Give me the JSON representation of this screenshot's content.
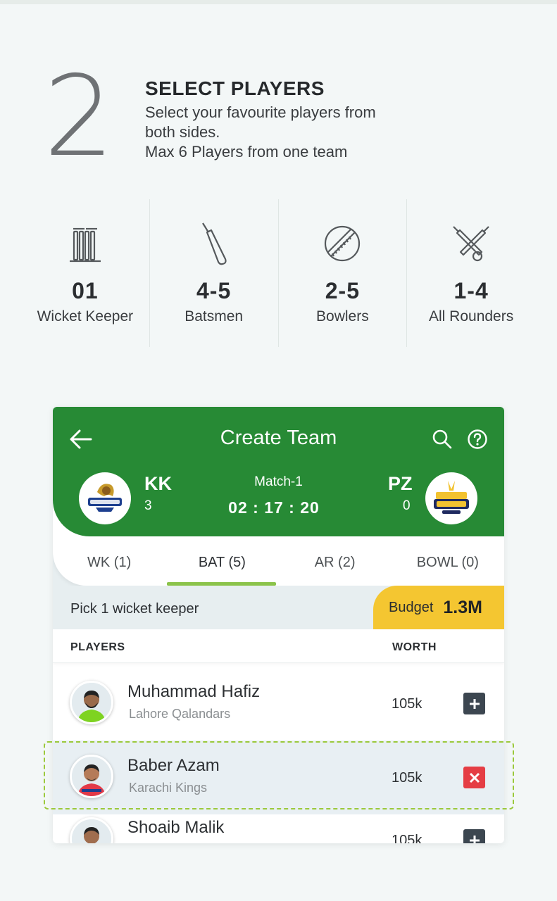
{
  "step": {
    "number": "2",
    "title": "SELECT PLAYERS",
    "desc_line1": "Select your favourite players from",
    "desc_line2": "both sides.",
    "desc_line3": "Max 6 Players from one team"
  },
  "roles": [
    {
      "icon": "wicket-stumps-icon",
      "count": "01",
      "label": "Wicket Keeper"
    },
    {
      "icon": "cricket-bat-icon",
      "count": "4-5",
      "label": "Batsmen"
    },
    {
      "icon": "cricket-ball-icon",
      "count": "2-5",
      "label": "Bowlers"
    },
    {
      "icon": "crossed-bats-icon",
      "count": "1-4",
      "label": "All Rounders"
    }
  ],
  "app": {
    "title": "Create Team",
    "team_left": {
      "code": "KK",
      "score": "3"
    },
    "team_right": {
      "code": "PZ",
      "score": "0"
    },
    "match_label": "Match-1",
    "timer": "02 : 17 : 20",
    "tabs": [
      {
        "label": "WK (1)",
        "active": false
      },
      {
        "label": "BAT (5)",
        "active": true
      },
      {
        "label": "AR (2)",
        "active": false
      },
      {
        "label": "BOWL (0)",
        "active": false
      }
    ],
    "pick_text": "Pick 1 wicket keeper",
    "budget_label": "Budget",
    "budget_value": "1.3M",
    "col_players": "PLAYERS",
    "col_worth": "WORTH",
    "players": [
      {
        "name": "Muhammad Hafiz",
        "team": "Lahore Qalandars",
        "worth": "105k",
        "action": "add",
        "jersey": "#7ed321"
      },
      {
        "name": "Baber Azam",
        "team": "Karachi Kings",
        "worth": "105k",
        "action": "remove",
        "jersey": "#e23a48"
      },
      {
        "name": "Shoaib Malik",
        "team": "",
        "worth": "105k",
        "action": "add",
        "jersey": "#2b6cc4"
      }
    ]
  },
  "colors": {
    "header_green": "#278a35",
    "budget_yellow": "#f4c631",
    "remove_red": "#e53d44",
    "tab_underline": "#8bc34a"
  }
}
